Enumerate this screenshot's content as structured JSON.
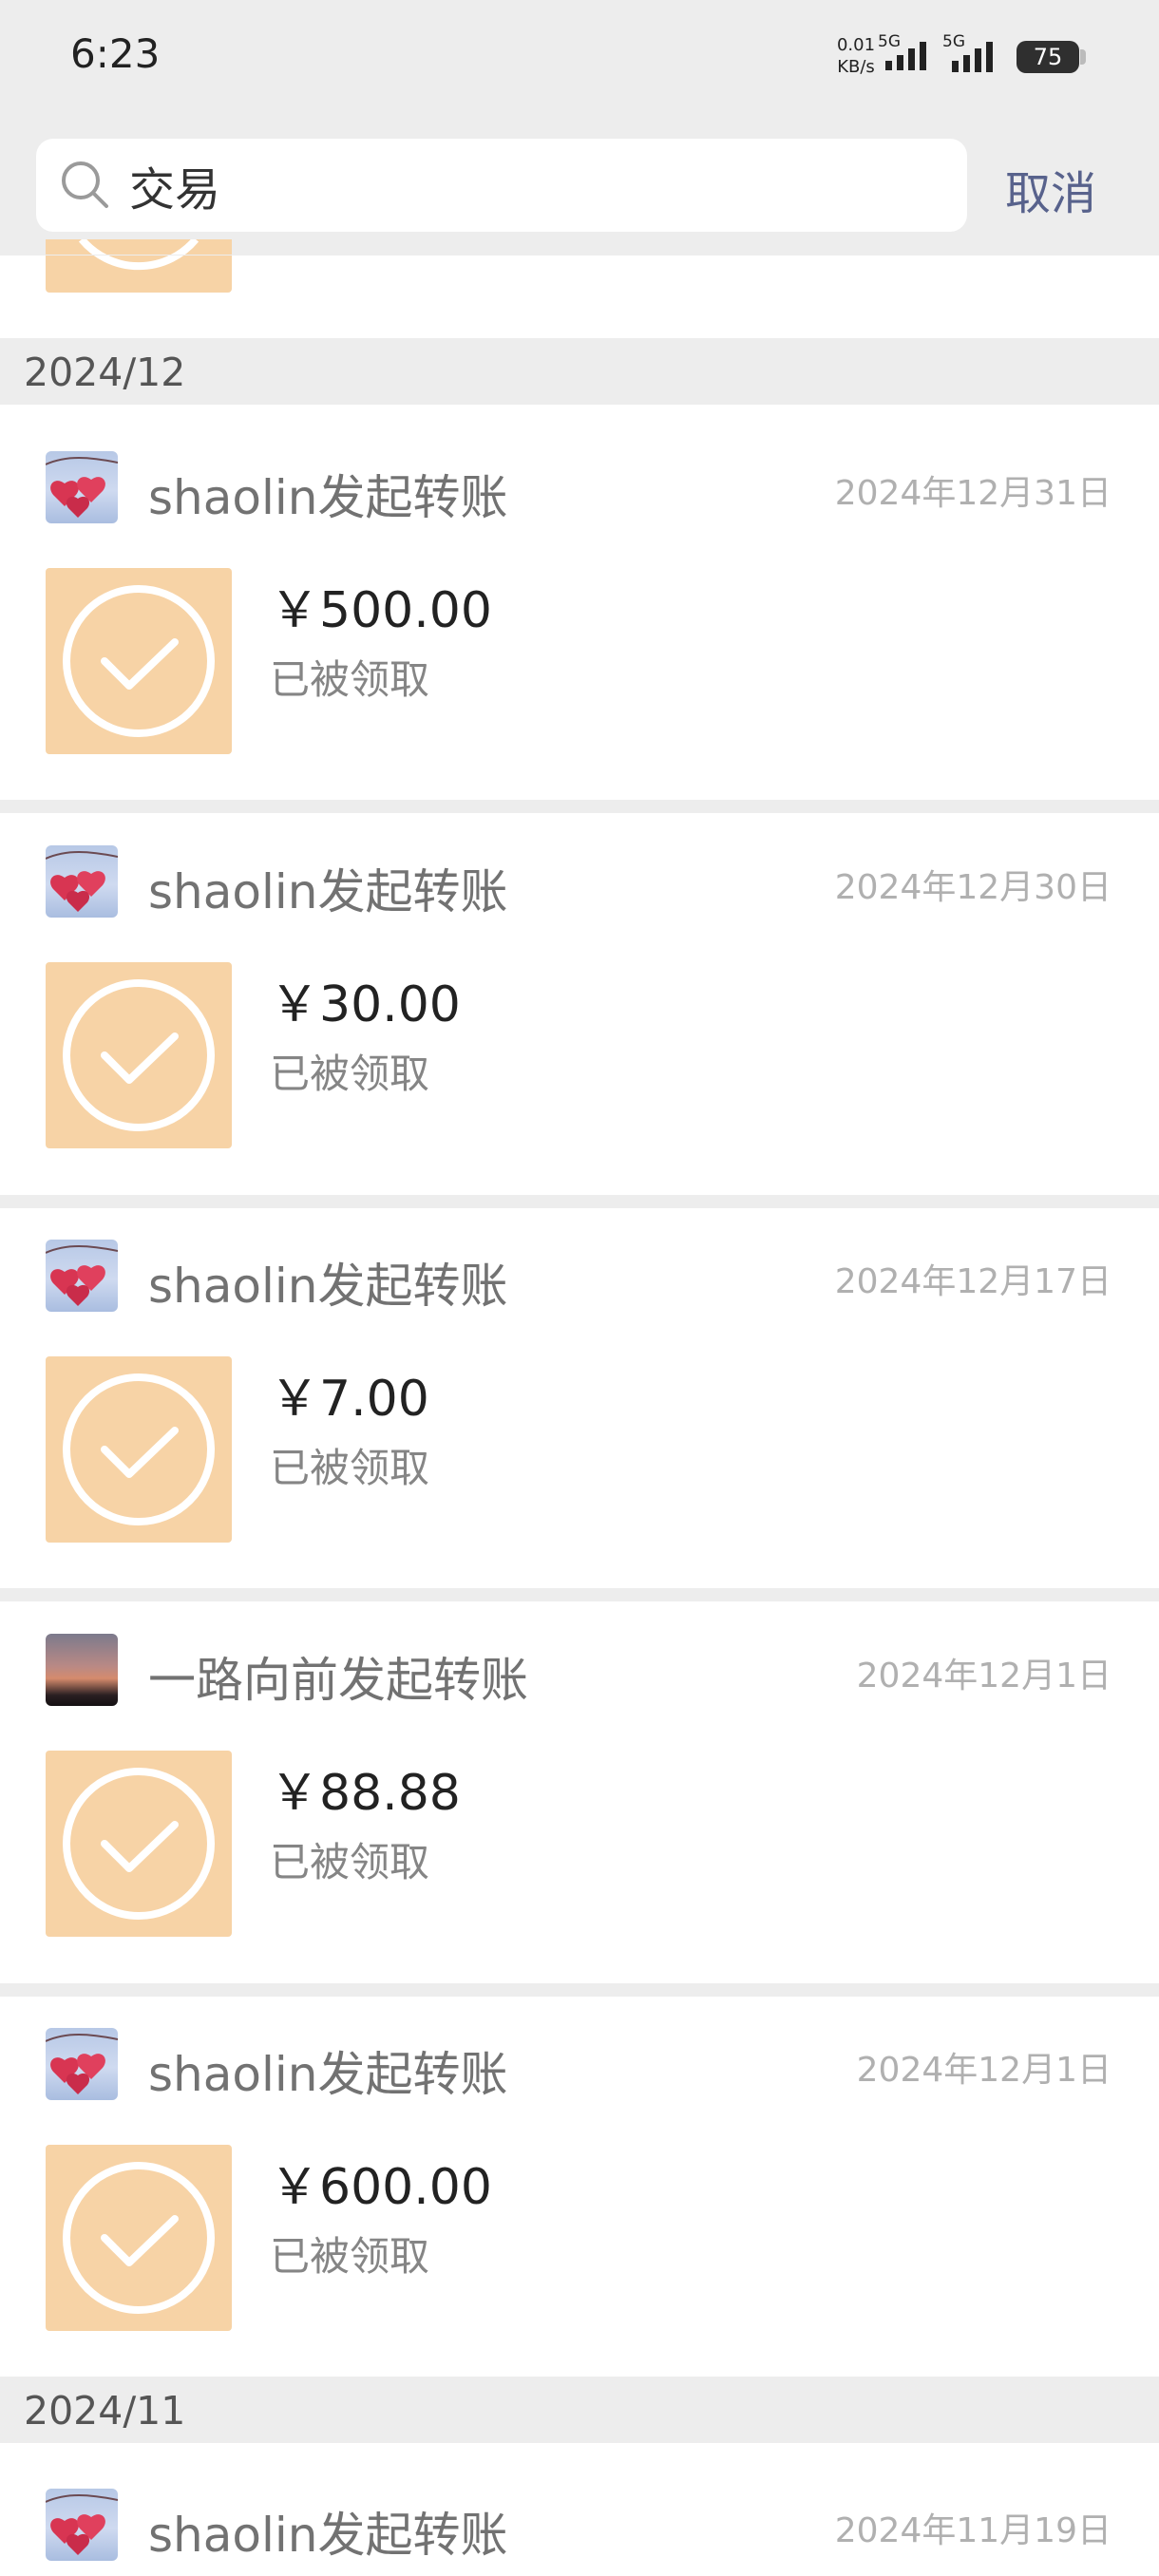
{
  "status_bar": {
    "time": "6:23",
    "net_speed_value": "0.01",
    "net_speed_unit": "KB/s",
    "signal1_label": "5G",
    "signal2_label": "5G",
    "battery": "75"
  },
  "search": {
    "query": "交易",
    "cancel_label": "取消"
  },
  "sections": [
    {
      "month": "2024/12",
      "items": [
        {
          "title": "shaolin发起转账",
          "date": "2024年12月31日",
          "amount": "￥500.00",
          "status": "已被领取",
          "avatar": "hearts"
        },
        {
          "title": "shaolin发起转账",
          "date": "2024年12月30日",
          "amount": "￥30.00",
          "status": "已被领取",
          "avatar": "hearts"
        },
        {
          "title": "shaolin发起转账",
          "date": "2024年12月17日",
          "amount": "￥7.00",
          "status": "已被领取",
          "avatar": "hearts"
        },
        {
          "title": "一路向前发起转账",
          "date": "2024年12月1日",
          "amount": "￥88.88",
          "status": "已被领取",
          "avatar": "sunset"
        },
        {
          "title": "shaolin发起转账",
          "date": "2024年12月1日",
          "amount": "￥600.00",
          "status": "已被领取",
          "avatar": "hearts"
        }
      ]
    },
    {
      "month": "2024/11",
      "items": [
        {
          "title": "shaolin发起转账",
          "date": "2024年11月19日",
          "avatar": "hearts"
        }
      ]
    }
  ],
  "colors": {
    "header_bg": "#ededed",
    "accent_link": "#58628c",
    "transfer_thumb": "#f7d3a6"
  }
}
